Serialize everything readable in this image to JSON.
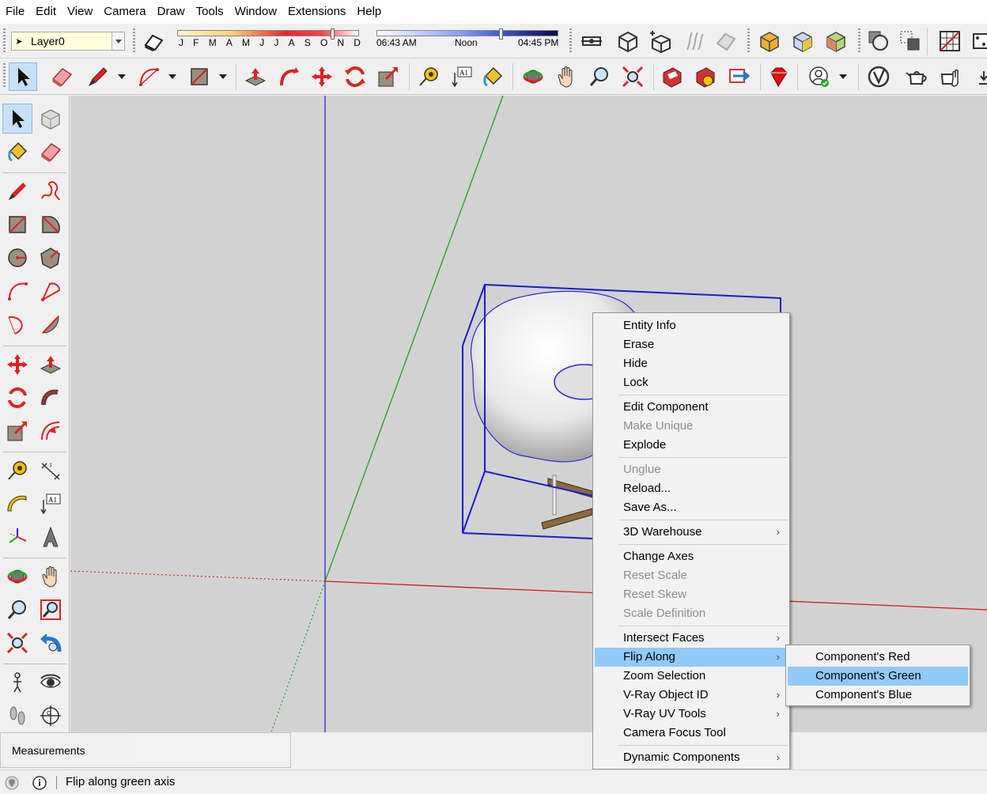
{
  "menubar": {
    "items": [
      "File",
      "Edit",
      "View",
      "Camera",
      "Draw",
      "Tools",
      "Window",
      "Extensions",
      "Help"
    ]
  },
  "layers": {
    "current": "Layer0"
  },
  "shadows": {
    "months": [
      "J",
      "F",
      "M",
      "A",
      "M",
      "J",
      "J",
      "A",
      "S",
      "O",
      "N",
      "D"
    ],
    "time_start": "06:43 AM",
    "time_mid": "Noon",
    "time_end": "04:45 PM"
  },
  "context_menu": {
    "items": [
      {
        "label": "Entity Info",
        "enabled": true
      },
      {
        "label": "Erase",
        "enabled": true
      },
      {
        "label": "Hide",
        "enabled": true
      },
      {
        "label": "Lock",
        "enabled": true
      },
      {
        "label": "Edit Component",
        "enabled": true
      },
      {
        "label": "Make Unique",
        "enabled": false
      },
      {
        "label": "Explode",
        "enabled": true
      },
      {
        "label": "Unglue",
        "enabled": false
      },
      {
        "label": "Reload...",
        "enabled": true
      },
      {
        "label": "Save As...",
        "enabled": true
      },
      {
        "label": "3D Warehouse",
        "enabled": true,
        "submenu": true
      },
      {
        "label": "Change Axes",
        "enabled": true
      },
      {
        "label": "Reset Scale",
        "enabled": false
      },
      {
        "label": "Reset Skew",
        "enabled": false
      },
      {
        "label": "Scale Definition",
        "enabled": false
      },
      {
        "label": "Intersect Faces",
        "enabled": true,
        "submenu": true
      },
      {
        "label": "Flip Along",
        "enabled": true,
        "submenu": true,
        "highlighted": true
      },
      {
        "label": "Zoom Selection",
        "enabled": true
      },
      {
        "label": "V-Ray Object ID",
        "enabled": true,
        "submenu": true
      },
      {
        "label": "V-Ray UV Tools",
        "enabled": true,
        "submenu": true
      },
      {
        "label": "Camera Focus Tool",
        "enabled": true
      },
      {
        "label": "Dynamic Components",
        "enabled": true,
        "submenu": true
      }
    ],
    "submenu_arrow": "›"
  },
  "flip_submenu": {
    "items": [
      {
        "label": "Component's Red"
      },
      {
        "label": "Component's Green",
        "highlighted": true
      },
      {
        "label": "Component's Blue"
      }
    ]
  },
  "measurements": {
    "label": "Measurements"
  },
  "status": {
    "message": "Flip along green axis"
  },
  "colors": {
    "viewport_bg": "#d2d2d2",
    "selection_blue": "#1a1ad6",
    "axis_red": "#cc1a1a",
    "axis_green": "#22a022",
    "axis_blue": "#2a2ad8",
    "menu_highlight": "#91c9f7"
  }
}
